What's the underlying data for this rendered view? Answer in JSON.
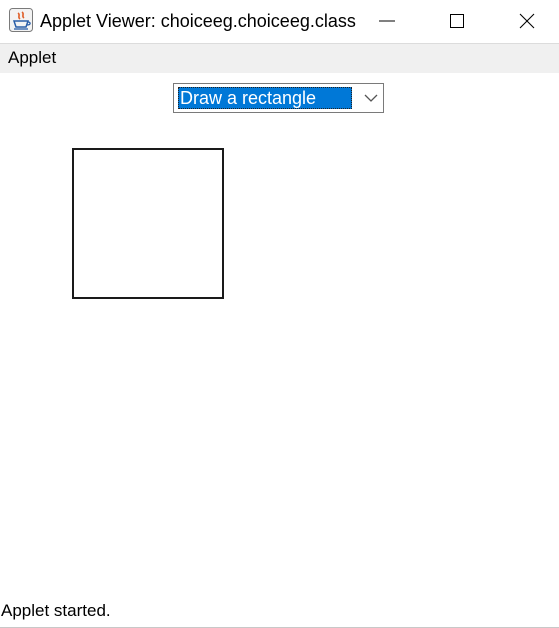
{
  "window": {
    "title": "Applet Viewer: choiceeg.choiceeg.class",
    "icon": "java-icon",
    "controls": {
      "minimize": "minimize-icon",
      "maximize": "maximize-icon",
      "close": "close-icon"
    }
  },
  "menubar": {
    "items": [
      {
        "label": "Applet"
      }
    ]
  },
  "applet": {
    "choice": {
      "selected": "Draw a rectangle",
      "selection_color": "#0078d7"
    },
    "canvas": {
      "shape": "rectangle"
    }
  },
  "status": {
    "text": "Applet started."
  }
}
